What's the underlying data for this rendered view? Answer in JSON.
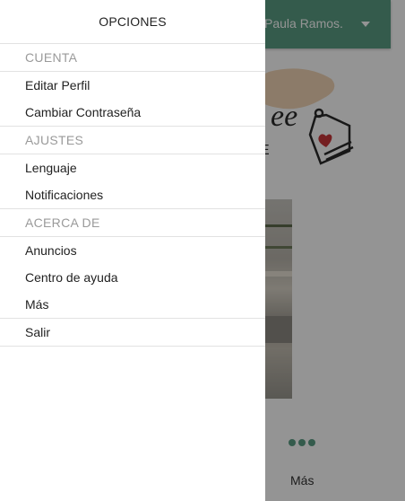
{
  "background": {
    "user_name": "Paula Ramos.",
    "more_label": "Más",
    "accent_color": "#5a9e84"
  },
  "drawer": {
    "title": "OPCIONES",
    "sections": [
      {
        "header": "CUENTA",
        "items": [
          "Editar Perfil",
          "Cambiar Contraseña"
        ]
      },
      {
        "header": "AJUSTES",
        "items": [
          "Lenguaje",
          "Notificaciones"
        ]
      },
      {
        "header": "ACERCA DE",
        "items": [
          "Anuncios",
          "Centro de ayuda",
          "Más"
        ]
      }
    ],
    "logout_label": "Salir"
  }
}
